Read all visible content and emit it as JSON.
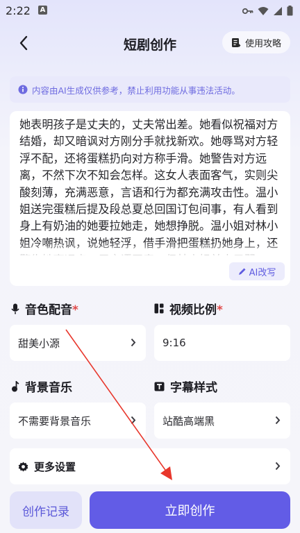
{
  "status_bar": {
    "time": "2:22",
    "app_badge": "A"
  },
  "header": {
    "title": "短剧创作",
    "guide_label": "使用攻略"
  },
  "notice": {
    "text": "内容由AI生成仅供参考，禁止利用功能从事违法活动。"
  },
  "script": {
    "text": "她表明孩子是丈夫的，丈夫常出差。她看似祝福对方结婚，却又暗讽对方刚分手就找新欢。她辱骂对方轻浮不配，还将蛋糕扔向对方称手滑。她警告对方远离，不然下次不知会怎样。这女人表面客气，实则尖酸刻薄，充满恶意，言语和行为都充满攻击性。温小姐送完蛋糕后提及段总夏总回国订包间事，有人看到身上有奶油的她要拉她走，她想挣脱。温小姐对林小姐冷嘲热讽，说她轻浮，借手滑把蛋糕扔她身上，还警告她离远点，用言语恶毒，但林小姐并未示弱",
    "ai_rewrite_label": "AI改写"
  },
  "voice": {
    "label": "音色配音",
    "required_mark": "*",
    "value": "甜美小源"
  },
  "ratio": {
    "label": "视频比例",
    "required_mark": "*",
    "value": "9:16"
  },
  "music": {
    "label": "背景音乐",
    "value": "不需要背景音乐"
  },
  "subtitle": {
    "label": "字幕样式",
    "value": "站酷高端黑"
  },
  "more_settings": {
    "label": "更多设置"
  },
  "bottom": {
    "history_label": "创作记录",
    "create_label": "立即创作"
  },
  "colors": {
    "accent": "#625ce6",
    "accent_light": "#e2e2f9",
    "required": "#e04a4a",
    "annotation": "#e8372c"
  }
}
